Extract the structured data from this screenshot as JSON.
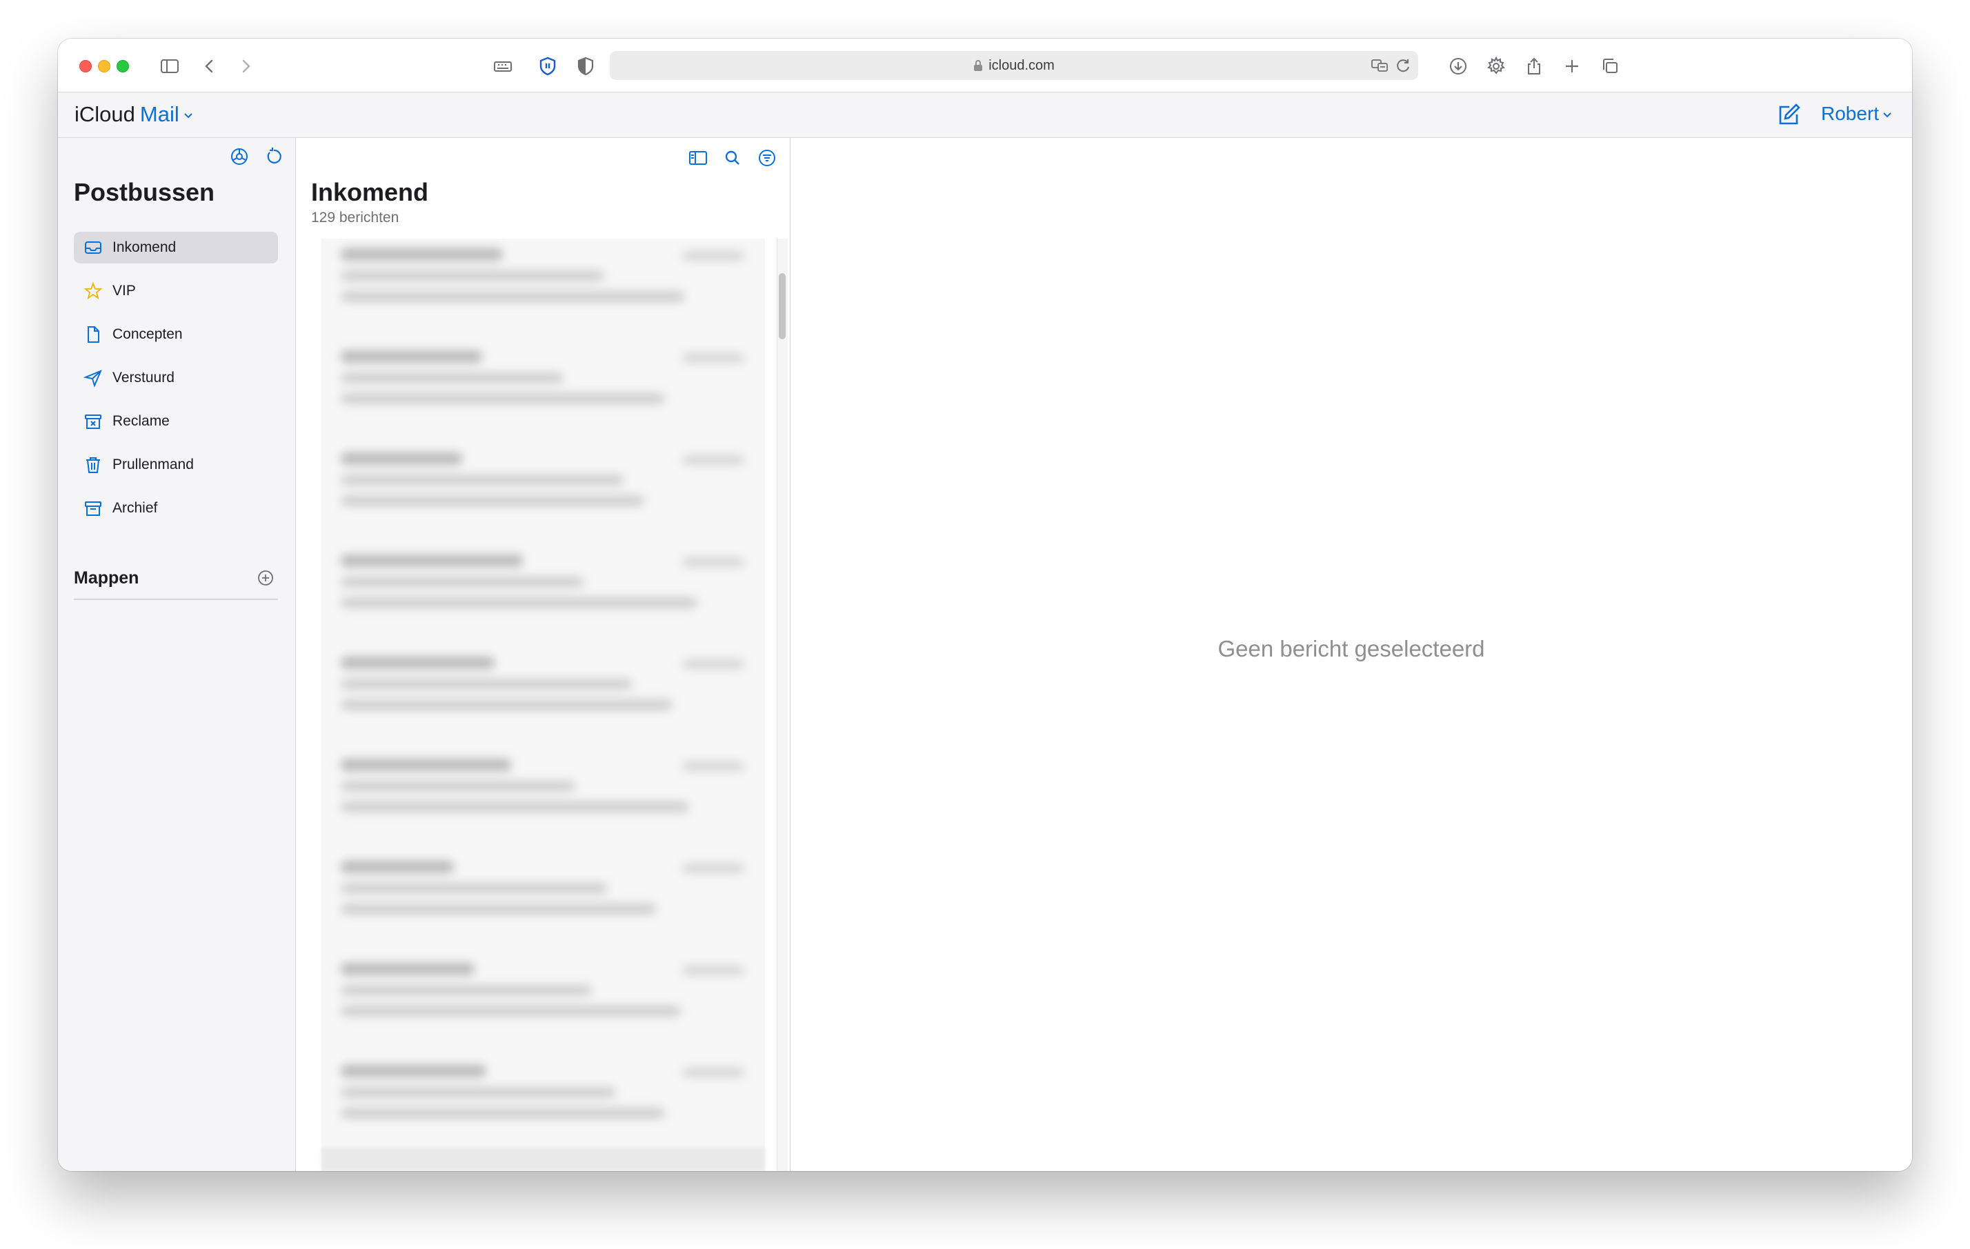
{
  "browser": {
    "url": "icloud.com"
  },
  "app": {
    "brand_primary": "iCloud",
    "brand_secondary": "Mail",
    "user_name": "Robert",
    "accent_color": "#0a6fd8"
  },
  "sidebar": {
    "title": "Postbussen",
    "mailboxes": [
      {
        "label": "Inkomend",
        "icon": "inbox-icon",
        "active": true
      },
      {
        "label": "VIP",
        "icon": "star-icon"
      },
      {
        "label": "Concepten",
        "icon": "document-icon"
      },
      {
        "label": "Verstuurd",
        "icon": "paperplane-icon"
      },
      {
        "label": "Reclame",
        "icon": "junk-icon"
      },
      {
        "label": "Prullenmand",
        "icon": "trash-icon"
      },
      {
        "label": "Archief",
        "icon": "archive-icon"
      }
    ],
    "folders_title": "Mappen"
  },
  "message_list": {
    "title": "Inkomend",
    "count_text": "129 berichten"
  },
  "reading_pane": {
    "empty_text": "Geen bericht geselecteerd"
  }
}
